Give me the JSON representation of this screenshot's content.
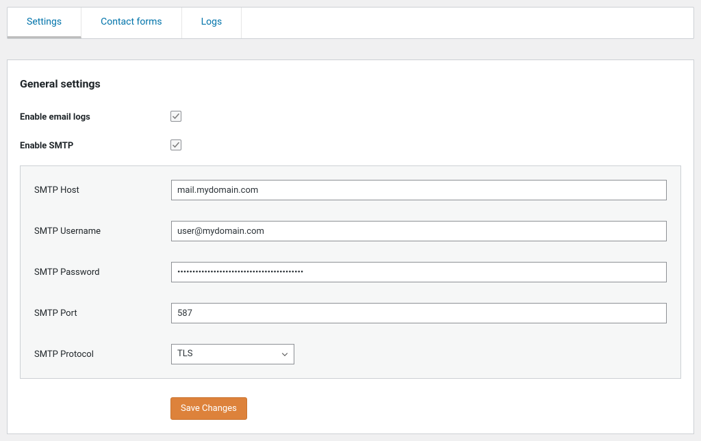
{
  "tabs": {
    "settings": "Settings",
    "contact_forms": "Contact forms",
    "logs": "Logs"
  },
  "page": {
    "title": "General settings"
  },
  "form": {
    "enable_email_logs": {
      "label": "Enable email logs",
      "checked": true
    },
    "enable_smtp": {
      "label": "Enable SMTP",
      "checked": true
    },
    "smtp_host": {
      "label": "SMTP Host",
      "value": "mail.mydomain.com"
    },
    "smtp_username": {
      "label": "SMTP Username",
      "value": "user@mydomain.com"
    },
    "smtp_password": {
      "label": "SMTP Password",
      "value": "••••••••••••••••••••••••••••••••••••••••••"
    },
    "smtp_port": {
      "label": "SMTP Port",
      "value": "587"
    },
    "smtp_protocol": {
      "label": "SMTP Protocol",
      "value": "TLS"
    },
    "submit_label": "Save Changes"
  }
}
